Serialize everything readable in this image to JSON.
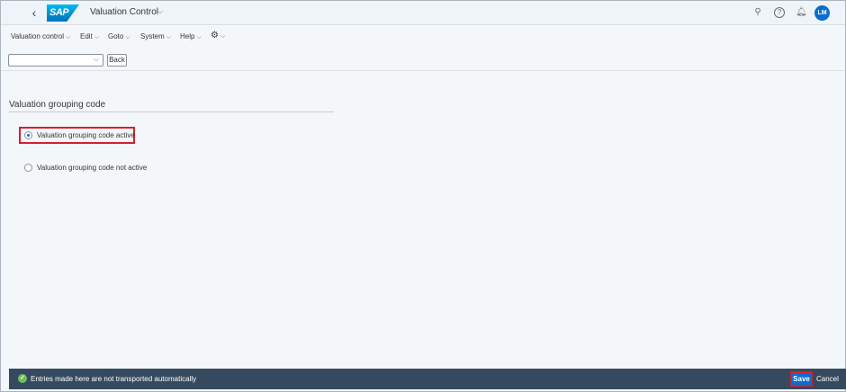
{
  "shell": {
    "back_glyph": "‹",
    "logo_text": "SAP",
    "app_title": "Valuation Control",
    "title_caret": "⌵",
    "icons": {
      "search": "⚲",
      "help": "?",
      "notifications": "🔔︎",
      "avatar_initials": "LM"
    }
  },
  "menu": {
    "items": [
      {
        "label": "Valuation control"
      },
      {
        "label": "Edit"
      },
      {
        "label": "Goto"
      },
      {
        "label": "System"
      },
      {
        "label": "Help"
      },
      {
        "label": "⚙"
      }
    ],
    "caret": "⌵"
  },
  "toolbar": {
    "okcode_value": "",
    "okcode_caret": "⌵",
    "back_label": "Back"
  },
  "content": {
    "section_title": "Valuation grouping code",
    "options": [
      {
        "label": "Valuation grouping code active",
        "selected": true
      },
      {
        "label": "Valuation grouping code not active",
        "selected": false
      }
    ]
  },
  "footer": {
    "message_icon": "✓",
    "message": "Entries made here are not transported automatically",
    "save_label": "Save",
    "cancel_label": "Cancel"
  },
  "colors": {
    "accent": "#0a6ed1",
    "footer_bg": "#354a5f",
    "highlight": "#d32030",
    "success": "#6fbf5a"
  }
}
